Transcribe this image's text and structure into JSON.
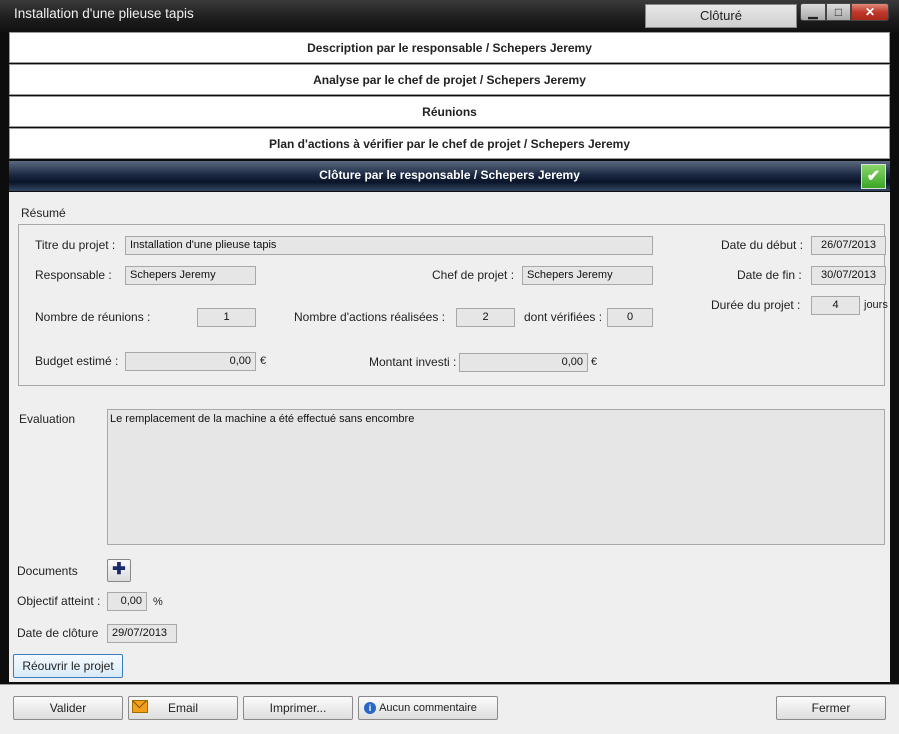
{
  "window": {
    "title": "Installation d'une plieuse tapis",
    "status_tab": "Clôturé",
    "min_glyph": "▁",
    "max_glyph": "□",
    "close_glyph": "✕"
  },
  "accordion": {
    "sections": [
      {
        "label": "Description par le responsable / Schepers Jeremy"
      },
      {
        "label": "Analyse par le chef de projet / Schepers Jeremy"
      },
      {
        "label": "Réunions"
      },
      {
        "label": "Plan d'actions à vérifier par le chef de projet / Schepers Jeremy"
      }
    ],
    "active": {
      "label": "Clôture par le responsable / Schepers Jeremy",
      "check_glyph": "✔"
    }
  },
  "resume": {
    "heading": "Résumé",
    "titre_label": "Titre du projet :",
    "titre_value": "Installation d'une plieuse tapis",
    "responsable_label": "Responsable :",
    "responsable_value": "Schepers Jeremy",
    "chef_label": "Chef de projet :",
    "chef_value": "Schepers Jeremy",
    "date_debut_label": "Date du début :",
    "date_debut_value": "26/07/2013",
    "date_fin_label": "Date de fin :",
    "date_fin_value": "30/07/2013",
    "duree_label": "Durée du projet :",
    "duree_value": "4",
    "duree_unit": "jours",
    "reunions_label": "Nombre de réunions :",
    "reunions_value": "1",
    "actions_label": "Nombre d'actions réalisées :",
    "actions_value": "2",
    "verifiees_label": "dont vérifiées :",
    "verifiees_value": "0",
    "budget_label": "Budget estimé :",
    "budget_value": "0,00",
    "budget_unit": "€",
    "montant_label": "Montant investi :",
    "montant_value": "0,00",
    "montant_unit": "€"
  },
  "evaluation": {
    "label": "Evaluation",
    "text": "Le remplacement de la machine a été effectué sans encombre"
  },
  "documents": {
    "label": "Documents",
    "add_glyph": "✚"
  },
  "objectif": {
    "label": "Objectif atteint :",
    "value": "0,00",
    "unit": "%"
  },
  "cloture": {
    "label": "Date de clôture",
    "value": "29/07/2013"
  },
  "reopen_button": "Réouvrir le projet",
  "footer": {
    "valider": "Valider",
    "email": "Email",
    "imprimer": "Imprimer...",
    "commentaire": "Aucun commentaire",
    "fermer": "Fermer"
  }
}
